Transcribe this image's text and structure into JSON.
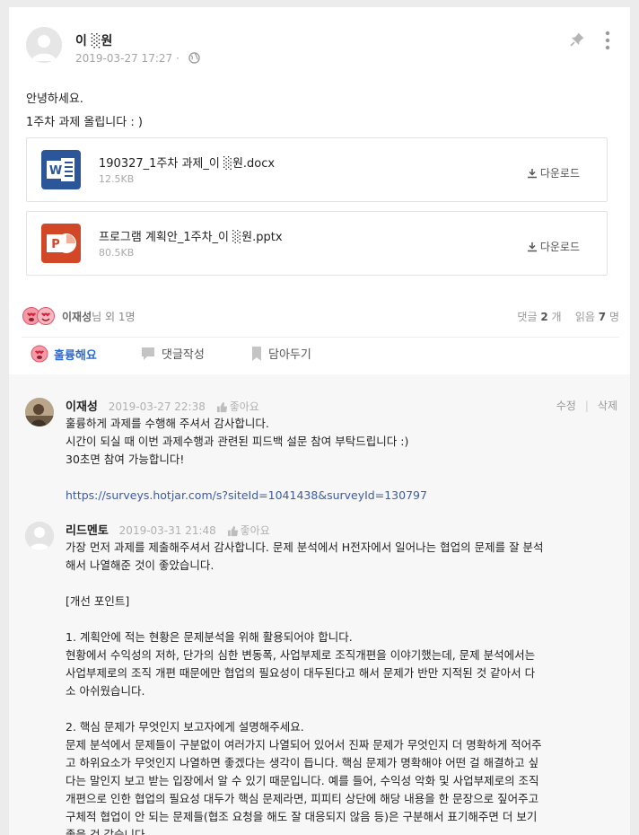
{
  "post": {
    "author": "이 ░원",
    "timestamp": "2019-03-27 17:27 ·",
    "body": [
      "안녕하세요.",
      "1주차 과제 올립니다 : )"
    ],
    "files": [
      {
        "name": "190327_1주차 과제_이 ░원.docx",
        "size": "12.5KB",
        "type": "word-icon",
        "color": "#2b579a"
      },
      {
        "name": "프로그램 계획안_1주차_이 ░원.pptx",
        "size": "80.5KB",
        "type": "powerpoint-icon",
        "color": "#d24726"
      }
    ],
    "download_label": "다운로드"
  },
  "reactions": {
    "names": "이재성",
    "suffix": "님 외 1명",
    "comment_label": "댓글",
    "comment_count": "2",
    "comment_unit": "개",
    "read_label": "읽음",
    "read_count": "7",
    "read_unit": "명"
  },
  "actions": {
    "like": "훌륭해요",
    "comment": "댓글작성",
    "save": "담아두기"
  },
  "comments": [
    {
      "author": "이재성",
      "timestamp": "2019-03-27 22:38",
      "like": "좋아요",
      "edit": "수정",
      "delete": "삭제",
      "lines": [
        "훌륭하게 과제를 수행해 주셔서 감사합니다.",
        "시간이 되실 때 이번 과제수행과 관련된 피드백 설문 참여 부탁드립니다 :)",
        "30초면 참여 가능합니다!",
        "",
        "https://surveys.hotjar.com/s?siteId=1041438&surveyId=130797"
      ]
    },
    {
      "author": "리드멘토",
      "timestamp": "2019-03-31 21:48",
      "like": "좋아요",
      "lines": [
        "가장 먼저 과제를 제출해주셔서 감사합니다. 문제 분석에서 H전자에서 일어나는 협업의 문제를 잘 분석",
        "해서 나열해준 것이 좋았습니다.",
        "",
        "[개선 포인트]",
        "",
        "1. 계획안에 적는 현황은 문제분석을 위해 활용되어야 합니다.",
        "현황에서 수익성의 저하, 단가의 심한 변동폭, 사업부제로 조직개편을 이야기했는데, 문제 분석에서는",
        " 사업부제로의 조직 개편 때문에만 협업의 필요성이 대두된다고 해서 문제가 반만 지적된 것 같아서 다",
        "소 아쉬웠습니다.",
        "",
        "2. 핵심 문제가 무엇인지 보고자에게 설명해주세요.",
        "문제 분석에서 문제들이 구분없이 여러가지 나열되어 있어서 진짜 문제가 무엇인지 더 명확하게 적어주",
        "고 하위요소가 무엇인지 나열하면 좋겠다는 생각이 듭니다. 핵심 문제가 명확해야 어떤 걸 해결하고 싶",
        "다는 말인지 보고 받는 입장에서 알 수 있기 때문입니다. 예를 들어, 수익성 악화 및 사업부제로의 조직",
        "개편으로 인한 협업의 필요성 대두가 핵심 문제라면, 피피티 상단에 해당 내용을 한 문장으로 짚어주고",
        " 구체적 협업이 안 되는 문제들(협조 요청을 해도 잘 대응되지 않음 등)은 구분해서 표기해주면 더 보기",
        " 좋을 것 같습니다."
      ]
    }
  ]
}
